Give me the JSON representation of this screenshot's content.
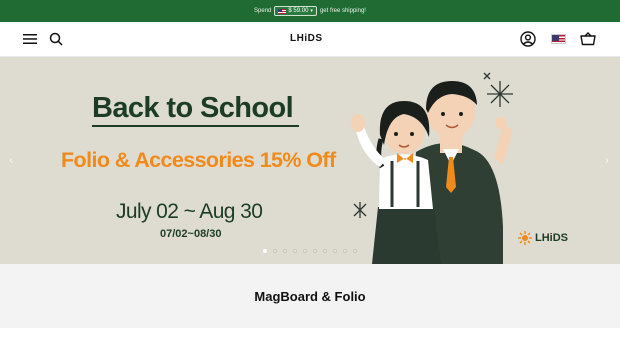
{
  "announcement": {
    "before": "Spend",
    "amount": "$ 59.00",
    "after": "get free shipping!"
  },
  "header": {
    "logo": "LHiDS",
    "menu_icon": "hamburger-menu-icon",
    "search_icon": "search-icon",
    "account_icon": "account-icon",
    "flag_icon": "us-flag-icon",
    "cart_icon": "cart-basket-icon"
  },
  "hero": {
    "title": "Back to School",
    "subtitle": "Folio & Accessories 15% Off",
    "dates": "July 02 ~ Aug 30",
    "dates_short": "07/02~08/30",
    "brand": "LHiDS",
    "slide_count": 10,
    "active_slide": 1
  },
  "section": {
    "title": "MagBoard & Folio"
  },
  "colors": {
    "announcement_bg": "#1f6b33",
    "hero_bg": "#dedcd0",
    "title_green": "#1d3c27",
    "accent_orange": "#f08a1b"
  }
}
